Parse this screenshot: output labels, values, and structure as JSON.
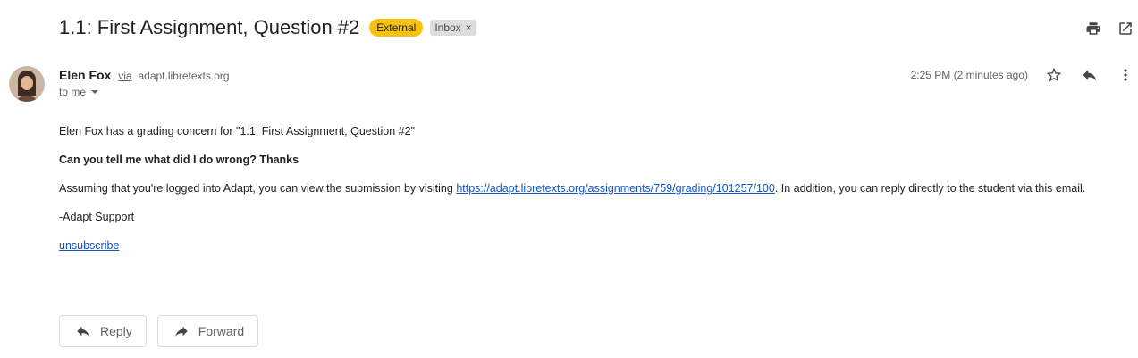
{
  "email": {
    "subject": "1.1: First Assignment, Question #2",
    "labels": {
      "external": "External",
      "inbox": "Inbox",
      "remove": "×"
    },
    "sender": {
      "name": "Elen Fox",
      "via_label": "via",
      "via_domain": "adapt.libretexts.org",
      "recipient": "to me"
    },
    "timestamp": "2:25 PM (2 minutes ago)",
    "body": {
      "intro": "Elen Fox has a grading concern for \"1.1: First Assignment, Question #2\"",
      "question": "Can you tell me what did I do wrong? Thanks",
      "instructions_before": "Assuming that you're logged into Adapt, you can view the submission by visiting ",
      "link": "https://adapt.libretexts.org/assignments/759/grading/101257/100",
      "instructions_after": ". In addition, you can reply directly to the student via this email.",
      "signature": "-Adapt Support",
      "unsubscribe": "unsubscribe"
    }
  },
  "actions": {
    "reply": "Reply",
    "forward": "Forward"
  },
  "icons": {
    "print": "print-icon",
    "open_new_window": "open-in-new-window-icon",
    "star": "star-icon",
    "reply": "reply-icon",
    "more": "more-vertical-icon"
  },
  "colors": {
    "external_badge": "#f9c10f",
    "inbox_badge": "#dddddd",
    "link": "#1155cc"
  }
}
